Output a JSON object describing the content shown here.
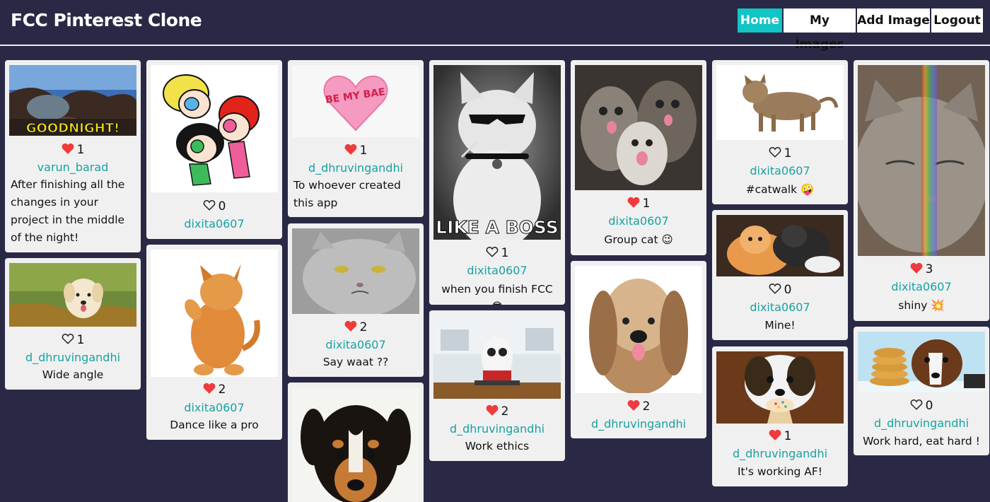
{
  "app": {
    "title": "FCC Pinterest Clone"
  },
  "nav": {
    "home": "Home",
    "my_images": "My Images",
    "add_image": "Add Image",
    "logout": "Logout"
  },
  "colors": {
    "background": "#2a2945",
    "accent": "#12c4c4",
    "username": "#17a2a2",
    "heart": "#ef3b3b"
  },
  "cards": {
    "c1": {
      "likes": "1",
      "liked": true,
      "user": "varun_barad",
      "caption": "After finishing all the changes in your project in the middle of the night!",
      "image_text": "GOODNIGHT!"
    },
    "c2": {
      "likes": "1",
      "liked": false,
      "user": "d_dhruvingandhi",
      "caption": "Wide angle"
    },
    "c3": {
      "likes": "0",
      "liked": false,
      "user": "dixita0607",
      "caption": ""
    },
    "c4": {
      "likes": "2",
      "liked": true,
      "user": "dixita0607",
      "caption": "Dance like a pro"
    },
    "c5": {
      "likes": "1",
      "liked": true,
      "user": "d_dhruvingandhi",
      "caption": "To whoever created this app",
      "image_text": "BE MY BAE"
    },
    "c6": {
      "likes": "2",
      "liked": true,
      "user": "dixita0607",
      "caption": "Say waat ??"
    },
    "c7": {
      "likes": "",
      "liked": false,
      "user": "",
      "caption": ""
    },
    "c8": {
      "likes": "1",
      "liked": false,
      "user": "dixita0607",
      "caption": "when you finish FCC 😎",
      "image_text": "LIKE A BOSS"
    },
    "c9": {
      "likes": "2",
      "liked": true,
      "user": "d_dhruvingandhi",
      "caption": "Work ethics"
    },
    "c10": {
      "likes": "1",
      "liked": true,
      "user": "dixita0607",
      "caption": "Group cat 😉"
    },
    "c11": {
      "likes": "2",
      "liked": true,
      "user": "d_dhruvingandhi",
      "caption": ""
    },
    "c12": {
      "likes": "1",
      "liked": false,
      "user": "dixita0607",
      "caption": "#catwalk 🤪"
    },
    "c13": {
      "likes": "0",
      "liked": false,
      "user": "dixita0607",
      "caption": "Mine!"
    },
    "c14": {
      "likes": "1",
      "liked": true,
      "user": "d_dhruvingandhi",
      "caption": "It's working AF!"
    },
    "c15": {
      "likes": "3",
      "liked": true,
      "user": "dixita0607",
      "caption": "shiny 💥"
    },
    "c16": {
      "likes": "0",
      "liked": false,
      "user": "d_dhruvingandhi",
      "caption": "Work hard, eat hard !"
    }
  }
}
